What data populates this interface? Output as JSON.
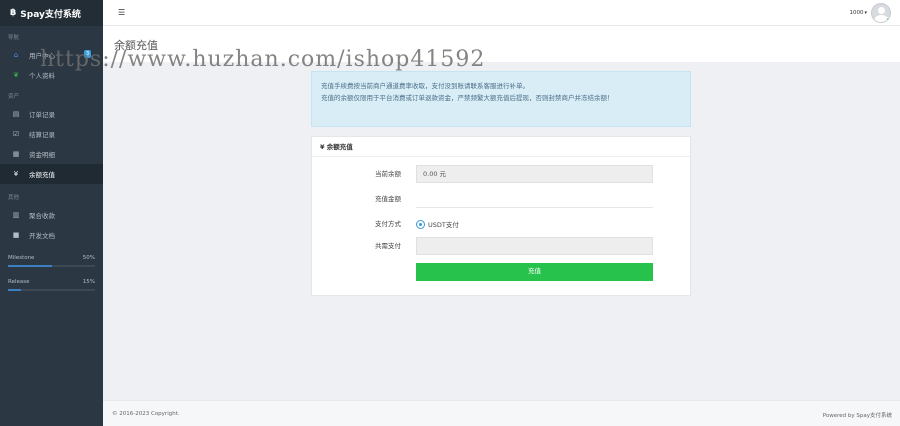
{
  "brand": {
    "logo": "฿",
    "name": "Spay支付系统"
  },
  "sidebar": {
    "groups": [
      {
        "title": "导航",
        "items": [
          {
            "icon": "home-icon",
            "glyph": "⌂",
            "label": "用户中心",
            "badge": "3"
          },
          {
            "icon": "leaf-icon",
            "glyph": "❦",
            "label": "个人资料"
          }
        ]
      },
      {
        "title": "资产",
        "items": [
          {
            "icon": "list-icon",
            "glyph": "▤",
            "label": "订单记录"
          },
          {
            "icon": "checklist-icon",
            "glyph": "☑",
            "label": "结算记录"
          },
          {
            "icon": "ledger-icon",
            "glyph": "▦",
            "label": "资金明细"
          },
          {
            "icon": "yen-icon",
            "glyph": "¥",
            "label": "余额充值",
            "active": true
          }
        ]
      },
      {
        "title": "其他",
        "items": [
          {
            "icon": "barcode-icon",
            "glyph": "▥",
            "label": "聚合收款"
          },
          {
            "icon": "book-icon",
            "glyph": "■",
            "label": "开发文档"
          }
        ]
      }
    ],
    "progress": [
      {
        "label": "Milestone",
        "value_text": "50%",
        "value": 0.5
      },
      {
        "label": "Release",
        "value_text": "15%",
        "value": 0.15
      }
    ]
  },
  "topbar": {
    "menu_glyph": "☰",
    "username": "1000",
    "caret": "▾"
  },
  "page": {
    "title": "余额充值"
  },
  "watermark": "https://www.huzhan.com/ishop41592",
  "notice": {
    "line1": "充值手续费按当前商户通道费率收取，支付没到账请联系客服进行补单。",
    "line2": "充值的余额仅限用于平台消费或订单退款资金，严禁频繁大额充值后提现，否则封禁商户并冻结余额！"
  },
  "panel": {
    "title": "¥ 余额充值",
    "fields": {
      "balance_label": "当前余额",
      "balance_value": "0.00 元",
      "amount_label": "充值金额",
      "amount_value": "",
      "method_label": "支付方式",
      "method_option": "USDT支付",
      "pay_label": "共需支付",
      "pay_value": ""
    },
    "submit_label": "充值"
  },
  "footer": {
    "copyright": "© 2016-2023 Copyright.",
    "powered": "Powered by Spay支付系统"
  },
  "colors": {
    "sidebar": "#2b3843",
    "accent": "#3aa0dc",
    "success": "#27c24c",
    "notice_bg": "#d9edf7"
  }
}
